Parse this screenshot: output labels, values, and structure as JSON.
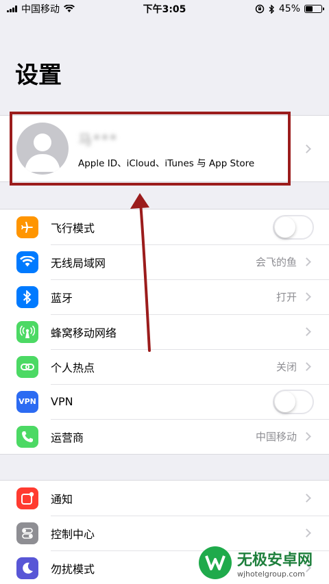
{
  "status_bar": {
    "carrier": "中国移动",
    "time": "下午3:05",
    "battery": "45%",
    "battery_level": 0.45
  },
  "page_title": "设置",
  "profile": {
    "name": "马***",
    "subtitle": "Apple ID、iCloud、iTunes 与 App Store"
  },
  "group1": [
    {
      "label": "飞行模式",
      "value": "",
      "toggle": true,
      "toggle_on": false,
      "icon": "airplane-icon",
      "color": "#ff9500"
    },
    {
      "label": "无线局域网",
      "value": "会飞的鱼",
      "icon": "wifi-icon",
      "color": "#007aff"
    },
    {
      "label": "蓝牙",
      "value": "打开",
      "icon": "bluetooth-icon",
      "color": "#007aff"
    },
    {
      "label": "蜂窝移动网络",
      "value": "",
      "icon": "cellular-icon",
      "color": "#4cd964"
    },
    {
      "label": "个人热点",
      "value": "关闭",
      "icon": "hotspot-icon",
      "color": "#4cd964"
    },
    {
      "label": "VPN",
      "value": "",
      "toggle": true,
      "toggle_on": false,
      "icon": "vpn-icon",
      "color": "#2c6bf2",
      "icon_text": "VPN"
    },
    {
      "label": "运营商",
      "value": "中国移动",
      "icon": "phone-icon",
      "color": "#4cd964"
    }
  ],
  "group2": [
    {
      "label": "通知",
      "value": "",
      "icon": "notification-icon",
      "color": "#ff3b30"
    },
    {
      "label": "控制中心",
      "value": "",
      "icon": "control-center-icon",
      "color": "#8e8e93"
    },
    {
      "label": "勿扰模式",
      "value": "",
      "icon": "moon-icon",
      "color": "#5856d6"
    }
  ],
  "watermark": {
    "title": "无极安卓网",
    "url": "wjhotelgroup.com"
  },
  "accent": "#9b1c1c"
}
